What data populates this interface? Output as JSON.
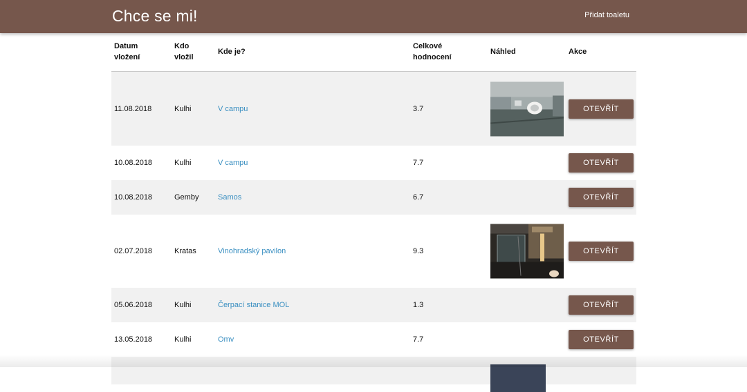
{
  "navbar": {
    "brand": "Chce se mi!",
    "add_link": "Přidat toaletu"
  },
  "table": {
    "headers": {
      "date_line1": "Datum",
      "date_line2": "vložení",
      "user_line1": "Kdo",
      "user_line2": "vložil",
      "place": "Kde je?",
      "score_line1": "Celkové",
      "score_line2": "hodnocení",
      "preview": "Náhled",
      "action": "Akce"
    },
    "action_label": "OTEVŘÍT",
    "rows": [
      {
        "date": "11.08.2018",
        "user": "Kulhi",
        "place": "V campu",
        "score": "3.7",
        "has_preview": true,
        "preview_icon": "toilet-photo"
      },
      {
        "date": "10.08.2018",
        "user": "Kulhi",
        "place": "V campu",
        "score": "7.7",
        "has_preview": false
      },
      {
        "date": "10.08.2018",
        "user": "Gemby",
        "place": "Samos",
        "score": "6.7",
        "has_preview": false
      },
      {
        "date": "02.07.2018",
        "user": "Kratas",
        "place": "Vinohradský pavilon",
        "score": "9.3",
        "has_preview": true,
        "preview_icon": "restroom-photo"
      },
      {
        "date": "05.06.2018",
        "user": "Kulhi",
        "place": "Čerpací stanice MOL",
        "score": "1.3",
        "has_preview": false
      },
      {
        "date": "13.05.2018",
        "user": "Kulhi",
        "place": "Omv",
        "score": "7.7",
        "has_preview": false
      }
    ]
  },
  "colors": {
    "brand": "#76574c",
    "link": "#3a8fc1",
    "row_alt": "#f1f1f1"
  }
}
